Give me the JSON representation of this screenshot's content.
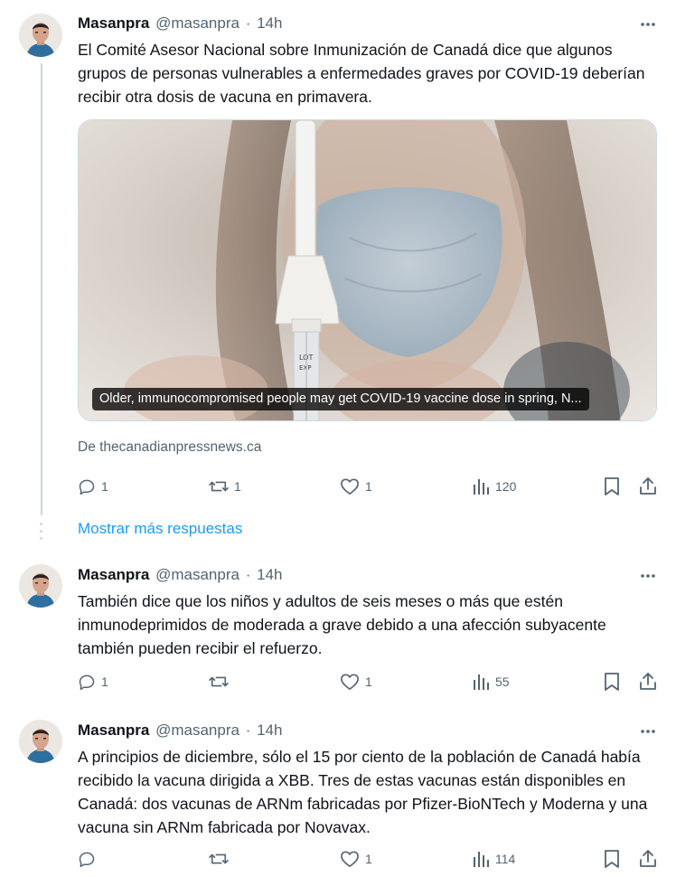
{
  "tweets": [
    {
      "name": "Masanpra",
      "handle": "@masanpra",
      "time": "14h",
      "text": "El Comité Asesor Nacional sobre Inmunización de Canadá dice que algunos grupos de personas vulnerables a enfermedades graves por COVID-19 deberían recibir otra dosis de vacuna en primavera.",
      "card": {
        "caption": "Older, immunocompromised people may get COVID-19 vaccine dose in spring, N...",
        "source": "De thecanadianpressnews.ca"
      },
      "stats": {
        "replies": "1",
        "reposts": "1",
        "likes": "1",
        "views": "120"
      }
    },
    {
      "name": "Masanpra",
      "handle": "@masanpra",
      "time": "14h",
      "text": "También dice que los niños y adultos de seis meses o más que estén inmunodeprimidos de moderada a grave debido a una afección subyacente también pueden recibir el refuerzo.",
      "stats": {
        "replies": "1",
        "reposts": "",
        "likes": "1",
        "views": "55"
      }
    },
    {
      "name": "Masanpra",
      "handle": "@masanpra",
      "time": "14h",
      "text": "A principios de diciembre, sólo el 15 por ciento de la población de Canadá había recibido la vacuna dirigida a XBB. Tres de estas vacunas están disponibles en Canadá: dos vacunas de ARNm fabricadas por Pfizer-BioNTech y Moderna y una vacuna sin ARNm fabricada por Novavax.",
      "stats": {
        "replies": "",
        "reposts": "",
        "likes": "1",
        "views": "114"
      }
    }
  ],
  "show_more_label": "Mostrar más respuestas",
  "icons": [
    "more-icon",
    "reply-icon",
    "repost-icon",
    "like-icon",
    "views-icon",
    "bookmark-icon",
    "share-icon"
  ],
  "colors": {
    "link": "#1d9bf0",
    "muted": "#536471",
    "text": "#0f1419",
    "thread_line": "#cfd9de"
  }
}
